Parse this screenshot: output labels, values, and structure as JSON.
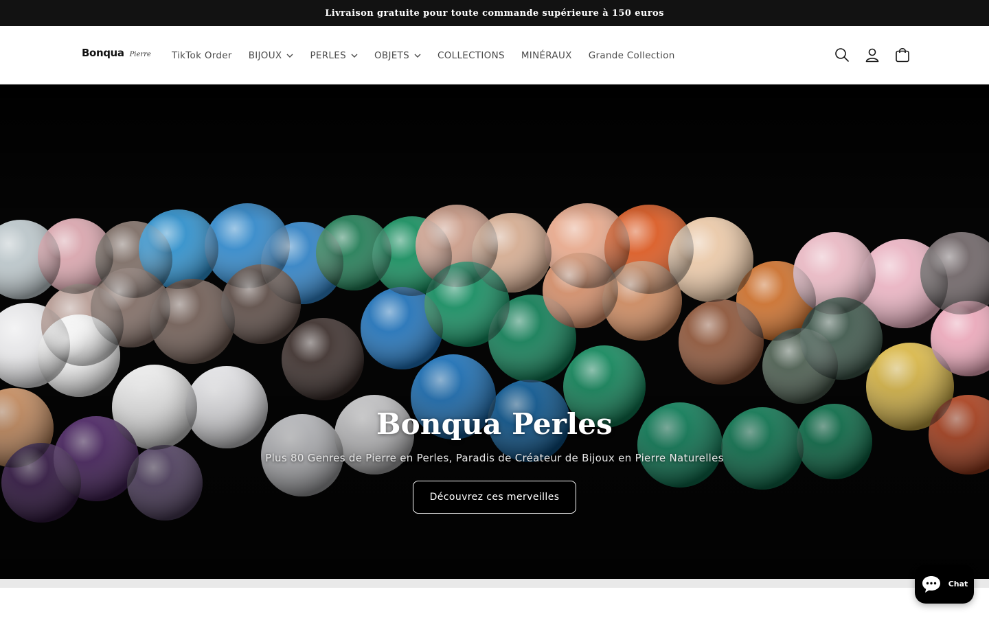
{
  "announcement": "Livraison gratuite pour toute commande supérieure à 150 euros",
  "header": {
    "logo": {
      "main": "Bonqua",
      "sub": "Pierre"
    },
    "nav": [
      {
        "label": "TikTok Order",
        "has_dropdown": false
      },
      {
        "label": "BIJOUX",
        "has_dropdown": true
      },
      {
        "label": "PERLES",
        "has_dropdown": true
      },
      {
        "label": "OBJETS",
        "has_dropdown": true
      },
      {
        "label": "COLLECTIONS",
        "has_dropdown": false
      },
      {
        "label": "MINÉRAUX",
        "has_dropdown": false
      },
      {
        "label": "Grande Collection",
        "has_dropdown": false
      }
    ],
    "icons": [
      "search-icon",
      "account-icon",
      "cart-icon"
    ]
  },
  "hero": {
    "title": "Bonqua Perles",
    "subtitle": "Plus 80 Genres de Pierre en Perles, Paradis de Créateur de Bijoux en Pierre Naturelles",
    "button": "Découvrez ces merveilles"
  },
  "chat": {
    "label": "Chat"
  },
  "colors": {
    "announcement_bg": "#121212",
    "hero_bg": "#000000",
    "button_bg": "#000000",
    "text": "#121212"
  }
}
